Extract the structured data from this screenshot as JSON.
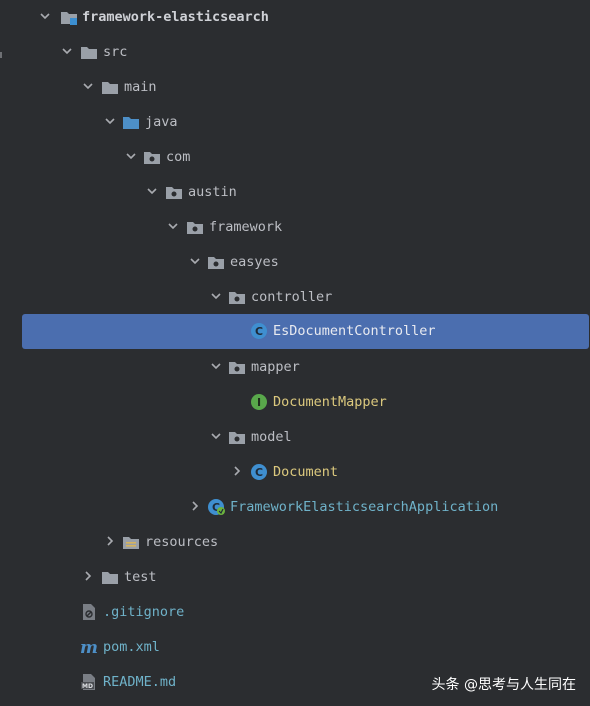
{
  "project_tree": {
    "items": [
      {
        "label": "framework-elasticsearch",
        "kind": "module",
        "state": "expanded"
      },
      {
        "label": "src",
        "kind": "folder",
        "state": "expanded"
      },
      {
        "label": "main",
        "kind": "folder",
        "state": "expanded"
      },
      {
        "label": "java",
        "kind": "source-root",
        "state": "expanded"
      },
      {
        "label": "com",
        "kind": "package",
        "state": "expanded"
      },
      {
        "label": "austin",
        "kind": "package",
        "state": "expanded"
      },
      {
        "label": "framework",
        "kind": "package",
        "state": "expanded"
      },
      {
        "label": "easyes",
        "kind": "package",
        "state": "expanded"
      },
      {
        "label": "controller",
        "kind": "package",
        "state": "expanded"
      },
      {
        "label": "EsDocumentController",
        "kind": "class",
        "state": "leaf",
        "selected": true
      },
      {
        "label": "mapper",
        "kind": "package",
        "state": "expanded"
      },
      {
        "label": "DocumentMapper",
        "kind": "interface",
        "state": "leaf"
      },
      {
        "label": "model",
        "kind": "package",
        "state": "expanded"
      },
      {
        "label": "Document",
        "kind": "class",
        "state": "collapsed"
      },
      {
        "label": "FrameworkElasticsearchApplication",
        "kind": "spring-boot-class",
        "state": "collapsed"
      },
      {
        "label": "resources",
        "kind": "resources-root",
        "state": "collapsed"
      },
      {
        "label": "test",
        "kind": "folder",
        "state": "collapsed"
      },
      {
        "label": ".gitignore",
        "kind": "gitignore-file",
        "state": "leaf"
      },
      {
        "label": "pom.xml",
        "kind": "maven-file",
        "state": "leaf"
      },
      {
        "label": "README.md",
        "kind": "markdown-file",
        "state": "leaf"
      }
    ]
  },
  "watermark": {
    "text": "头条 @思考与人生同在"
  },
  "colors": {
    "background": "#2b2d30",
    "selection": "#4b6eaf",
    "text": "#bcbec4",
    "class_text": "#dcc97e",
    "vcs_new_text": "#6fb2c9",
    "folder": "#9aa0a8",
    "source_root": "#4d8fc7",
    "class_icon": "#3f8fd0",
    "interface_icon": "#59a84b"
  }
}
